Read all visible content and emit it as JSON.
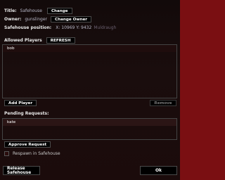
{
  "title_row": {
    "label": "Title:",
    "value": "Safehouse",
    "button": "Change"
  },
  "owner_row": {
    "label": "Owner:",
    "value": "gunslinger",
    "button": "Change Owner"
  },
  "position_row": {
    "label": "Safehouse position:",
    "value": "X: 10969 Y: 9432",
    "place": "Muldraugh"
  },
  "allowed_players": {
    "label": "Allowed Players",
    "refresh_button": "REFRESH",
    "items": [
      "bob"
    ],
    "add_button": "Add Player",
    "remove_button": "Remove"
  },
  "pending": {
    "label": "Pending Requests:",
    "items": [
      "kate"
    ],
    "approve_button": "Approve Request"
  },
  "respawn": {
    "label": "Respawn in Safehouse",
    "checked": false
  },
  "footer": {
    "release_button": "Release Safehouse",
    "ok_button": "Ok"
  }
}
